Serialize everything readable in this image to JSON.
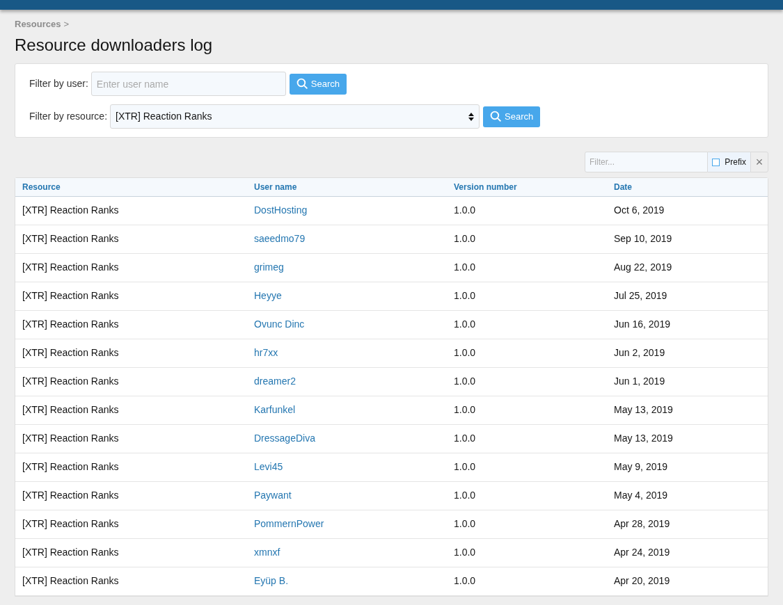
{
  "breadcrumb": [
    {
      "label": "Resources",
      "separator": ">"
    }
  ],
  "title": "Resource downloaders log",
  "filters": [
    {
      "label": "Filter by user:",
      "kind": "text",
      "placeholder": "Enter user name",
      "button": "Search"
    },
    {
      "label": "Filter by resource:",
      "kind": "select",
      "value": "[XTR] Reaction Ranks",
      "button": "Search"
    }
  ],
  "quick_filter": {
    "placeholder": "Filter...",
    "prefix": {
      "label": "Prefix",
      "checked": false
    },
    "clear": "×"
  },
  "table": {
    "columns": [
      "Resource",
      "User name",
      "Version number",
      "Date"
    ],
    "rows": [
      [
        "[XTR] Reaction Ranks",
        "DostHosting",
        "1.0.0",
        "Oct 6, 2019"
      ],
      [
        "[XTR] Reaction Ranks",
        "saeedmo79",
        "1.0.0",
        "Sep 10, 2019"
      ],
      [
        "[XTR] Reaction Ranks",
        "grimeg",
        "1.0.0",
        "Aug 22, 2019"
      ],
      [
        "[XTR] Reaction Ranks",
        "Heyye",
        "1.0.0",
        "Jul 25, 2019"
      ],
      [
        "[XTR] Reaction Ranks",
        "Ovunc Dinc",
        "1.0.0",
        "Jun 16, 2019"
      ],
      [
        "[XTR] Reaction Ranks",
        "hr7xx",
        "1.0.0",
        "Jun 2, 2019"
      ],
      [
        "[XTR] Reaction Ranks",
        "dreamer2",
        "1.0.0",
        "Jun 1, 2019"
      ],
      [
        "[XTR] Reaction Ranks",
        "Karfunkel",
        "1.0.0",
        "May 13, 2019"
      ],
      [
        "[XTR] Reaction Ranks",
        "DressageDiva",
        "1.0.0",
        "May 13, 2019"
      ],
      [
        "[XTR] Reaction Ranks",
        "Levi45",
        "1.0.0",
        "May 9, 2019"
      ],
      [
        "[XTR] Reaction Ranks",
        "Paywant",
        "1.0.0",
        "May 4, 2019"
      ],
      [
        "[XTR] Reaction Ranks",
        "PommernPower",
        "1.0.0",
        "Apr 28, 2019"
      ],
      [
        "[XTR] Reaction Ranks",
        "xmnxf",
        "1.0.0",
        "Apr 24, 2019"
      ],
      [
        "[XTR] Reaction Ranks",
        "Eyüp B.",
        "1.0.0",
        "Apr 20, 2019"
      ]
    ]
  }
}
